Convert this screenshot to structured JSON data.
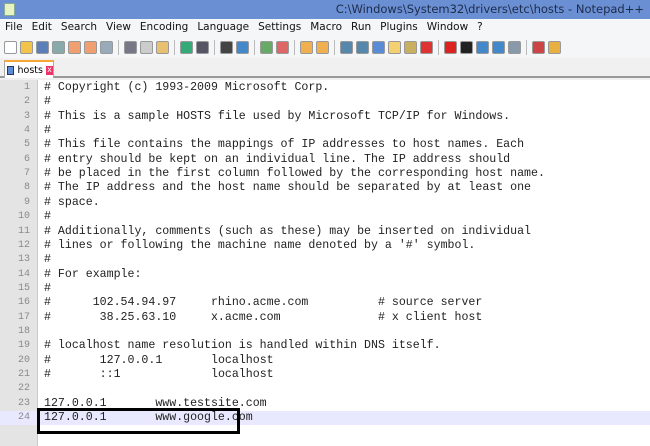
{
  "title": "C:\\Windows\\System32\\drivers\\etc\\hosts - Notepad++",
  "menu": [
    "File",
    "Edit",
    "Search",
    "View",
    "Encoding",
    "Language",
    "Settings",
    "Macro",
    "Run",
    "Plugins",
    "Window",
    "?"
  ],
  "tab": {
    "label": "hosts",
    "close": "x"
  },
  "lines": [
    "# Copyright (c) 1993-2009 Microsoft Corp.",
    "#",
    "# This is a sample HOSTS file used by Microsoft TCP/IP for Windows.",
    "#",
    "# This file contains the mappings of IP addresses to host names. Each",
    "# entry should be kept on an individual line. The IP address should",
    "# be placed in the first column followed by the corresponding host name.",
    "# The IP address and the host name should be separated by at least one",
    "# space.",
    "#",
    "# Additionally, comments (such as these) may be inserted on individual",
    "# lines or following the machine name denoted by a '#' symbol.",
    "#",
    "# For example:",
    "#",
    "#      102.54.94.97     rhino.acme.com          # source server",
    "#       38.25.63.10     x.acme.com              # x client host",
    "",
    "# localhost name resolution is handled within DNS itself.",
    "#\t127.0.0.1       localhost",
    "#\t::1             localhost",
    "",
    "127.0.0.1       www.testsite.com",
    "127.0.0.1       www.google.com"
  ],
  "current_line": 24
}
